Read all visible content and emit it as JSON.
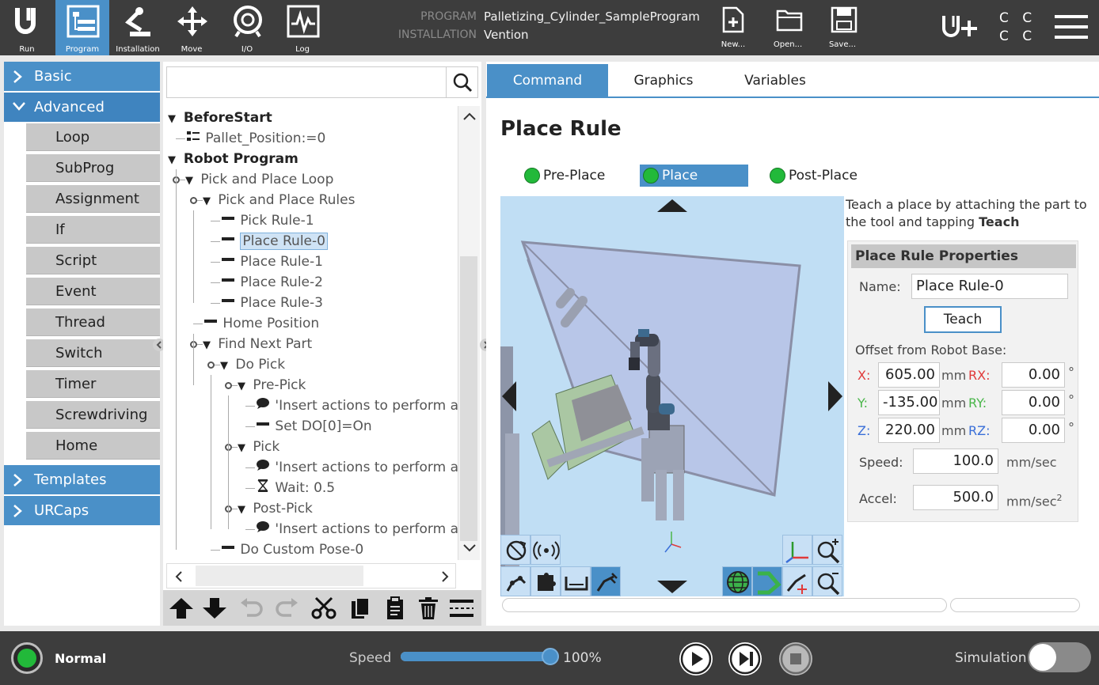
{
  "topbar": {
    "nav": [
      {
        "label": "Run",
        "icon": "ur-logo-icon"
      },
      {
        "label": "Program",
        "icon": "program-icon"
      },
      {
        "label": "Installation",
        "icon": "installation-icon"
      },
      {
        "label": "Move",
        "icon": "move-icon"
      },
      {
        "label": "I/O",
        "icon": "io-icon"
      },
      {
        "label": "Log",
        "icon": "log-icon"
      }
    ],
    "program_label": "PROGRAM",
    "program_value": "Palletizing_Cylinder_SampleProgram",
    "installation_label": "INSTALLATION",
    "installation_value": "Vention",
    "file_buttons": [
      {
        "label": "New...",
        "icon": "new-file-icon"
      },
      {
        "label": "Open...",
        "icon": "open-folder-icon"
      },
      {
        "label": "Save...",
        "icon": "save-icon"
      }
    ],
    "ccc": "C C\nC C"
  },
  "categories": {
    "basic": "Basic",
    "advanced": "Advanced",
    "advanced_items": [
      "Loop",
      "SubProg",
      "Assignment",
      "If",
      "Script",
      "Event",
      "Thread",
      "Switch",
      "Timer",
      "Screwdriving",
      "Home"
    ],
    "templates": "Templates",
    "urcaps": "URCaps"
  },
  "search": {
    "placeholder": ""
  },
  "tree": [
    {
      "label": "BeforeStart",
      "level": 0,
      "expander": "▼",
      "icon": "",
      "bold": true,
      "pin": false
    },
    {
      "label": "Pallet_Position:=0",
      "level": 1,
      "expander": "",
      "icon": "assignment",
      "bold": false,
      "pin": false
    },
    {
      "label": "Robot Program",
      "level": 0,
      "expander": "▼",
      "icon": "",
      "bold": true,
      "pin": false
    },
    {
      "label": "Pick and Place Loop",
      "level": 1,
      "expander": "▼",
      "icon": "",
      "bold": false,
      "pin": true
    },
    {
      "label": "Pick and Place Rules",
      "level": 2,
      "expander": "▼",
      "icon": "",
      "bold": false,
      "pin": true
    },
    {
      "label": "Pick Rule-1",
      "level": 3,
      "expander": "",
      "icon": "line",
      "bold": false,
      "pin": false
    },
    {
      "label": "Place Rule-0",
      "level": 3,
      "expander": "",
      "icon": "line",
      "bold": false,
      "pin": false,
      "selected": true
    },
    {
      "label": "Place Rule-1",
      "level": 3,
      "expander": "",
      "icon": "line",
      "bold": false,
      "pin": false
    },
    {
      "label": "Place Rule-2",
      "level": 3,
      "expander": "",
      "icon": "line",
      "bold": false,
      "pin": false
    },
    {
      "label": "Place Rule-3",
      "level": 3,
      "expander": "",
      "icon": "line",
      "bold": false,
      "pin": false
    },
    {
      "label": "Home Position",
      "level": 2,
      "expander": "",
      "icon": "line",
      "bold": false,
      "pin": false
    },
    {
      "label": "Find Next Part",
      "level": 2,
      "expander": "▼",
      "icon": "",
      "bold": false,
      "pin": true
    },
    {
      "label": "Do Pick",
      "level": 3,
      "expander": "▼",
      "icon": "",
      "bold": false,
      "pin": true
    },
    {
      "label": "Pre-Pick",
      "level": 4,
      "expander": "▼",
      "icon": "",
      "bold": false,
      "pin": true
    },
    {
      "label": "'Insert actions to perform a",
      "level": 5,
      "expander": "",
      "icon": "comment",
      "bold": false,
      "pin": false
    },
    {
      "label": "Set DO[0]=On",
      "level": 5,
      "expander": "",
      "icon": "line",
      "bold": false,
      "pin": false
    },
    {
      "label": "Pick",
      "level": 4,
      "expander": "▼",
      "icon": "",
      "bold": false,
      "pin": true
    },
    {
      "label": "'Insert actions to perform a",
      "level": 5,
      "expander": "",
      "icon": "comment",
      "bold": false,
      "pin": false
    },
    {
      "label": "Wait: 0.5",
      "level": 5,
      "expander": "",
      "icon": "wait",
      "bold": false,
      "pin": false
    },
    {
      "label": "Post-Pick",
      "level": 4,
      "expander": "▼",
      "icon": "",
      "bold": false,
      "pin": true
    },
    {
      "label": "'Insert actions to perform a",
      "level": 5,
      "expander": "",
      "icon": "comment",
      "bold": false,
      "pin": false
    },
    {
      "label": "Do Custom Pose-0",
      "level": 3,
      "expander": "",
      "icon": "line",
      "bold": false,
      "pin": false
    }
  ],
  "tabs": [
    "Command",
    "Graphics",
    "Variables"
  ],
  "rule": {
    "title": "Place Rule",
    "subtabs": [
      "Pre-Place",
      "Place",
      "Post-Place"
    ],
    "instruction_part1": "Teach a place by attaching the part to the tool and tapping ",
    "instruction_bold": "Teach",
    "properties_title": "Place Rule Properties",
    "name_label": "Name:",
    "name_value": "Place Rule-0",
    "teach_button": "Teach",
    "offset_label": "Offset from Robot Base:",
    "x_label": "X:",
    "x_value": "605.00",
    "y_label": "Y:",
    "y_value": "-135.00",
    "z_label": "Z:",
    "z_value": "220.00",
    "rx_label": "RX:",
    "rx_value": "0.00",
    "ry_label": "RY:",
    "ry_value": "0.00",
    "rz_label": "RZ:",
    "rz_value": "0.00",
    "mm": "mm",
    "deg": "°",
    "speed_label": "Speed:",
    "speed_value": "100.0",
    "speed_unit": "mm/sec",
    "accel_label": "Accel:",
    "accel_value": "500.0",
    "accel_unit": "mm/sec",
    "accel_exp": "2"
  },
  "footer": {
    "status": "Normal",
    "speed_label": "Speed",
    "speed_value": "100%",
    "speed_fraction": 1.0,
    "simulation_label": "Simulation"
  },
  "colors": {
    "accent": "#4a90c8",
    "status_green": "#22b93a",
    "bar": "#3d3d3d"
  }
}
